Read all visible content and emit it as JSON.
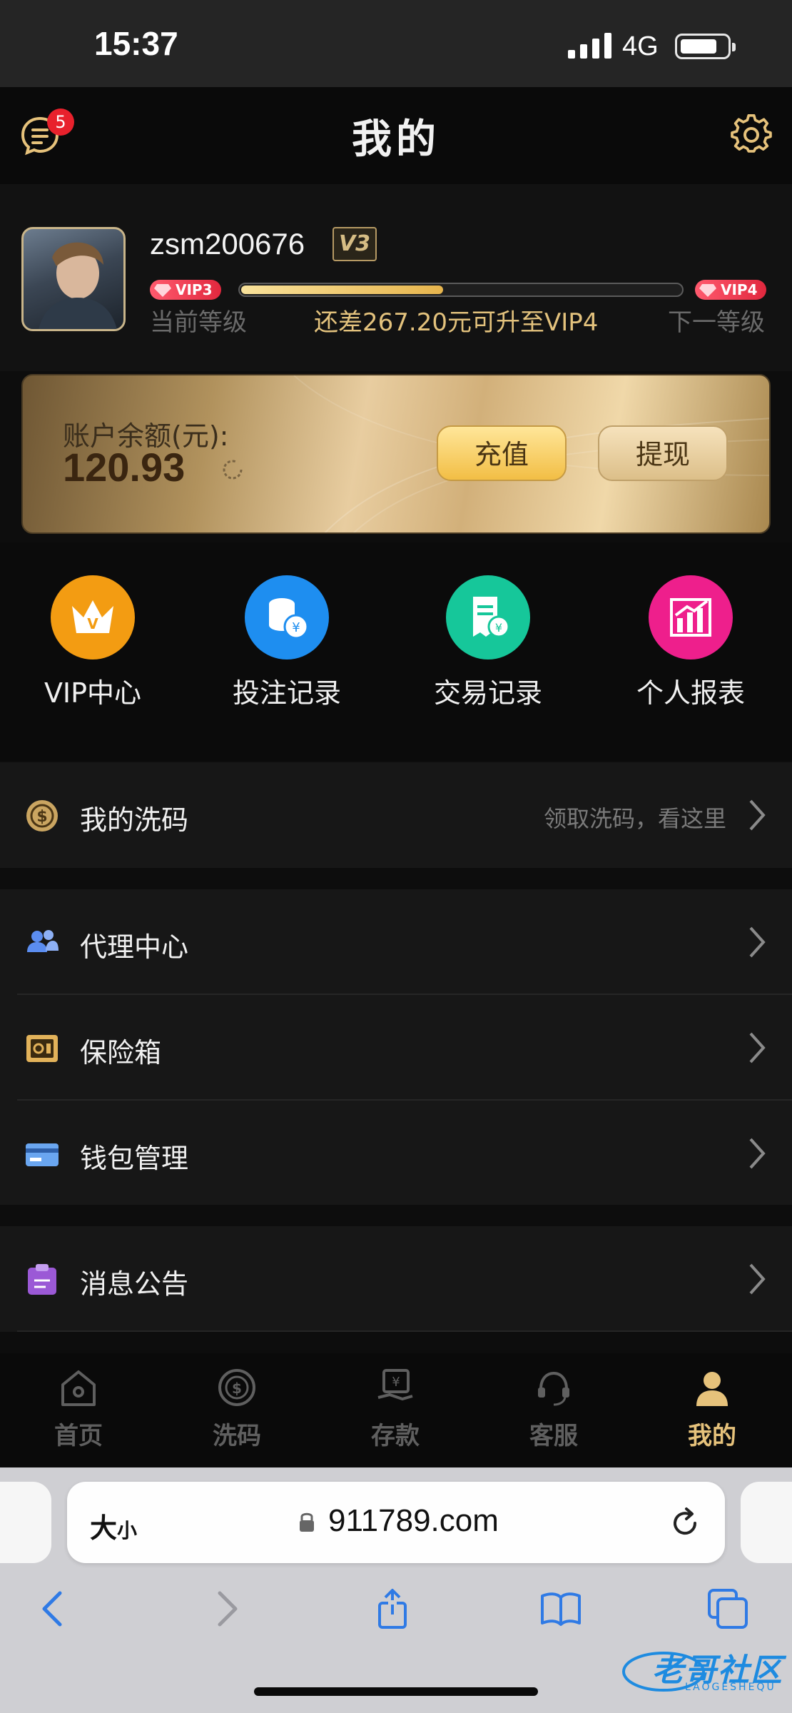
{
  "status_bar": {
    "time": "15:37",
    "network": "4G"
  },
  "header": {
    "title": "我的",
    "message_badge": "5"
  },
  "profile": {
    "username": "zsm200676",
    "level_badge": "V3",
    "current_vip": "VIP3",
    "next_vip": "VIP4",
    "current_level_label": "当前等级",
    "next_level_label": "下一等级",
    "upgrade_tip": "还差267.20元可升至VIP4",
    "progress_fraction": 0.46
  },
  "balance": {
    "label": "账户余额(元):",
    "value": "120.93",
    "charge_label": "充值",
    "withdraw_label": "提现"
  },
  "quick_actions": [
    {
      "label": "VIP中心",
      "icon": "crown-icon",
      "color": "#f39c12"
    },
    {
      "label": "投注记录",
      "icon": "coins-icon",
      "color": "#1e8ef0"
    },
    {
      "label": "交易记录",
      "icon": "receipt-icon",
      "color": "#16c79a"
    },
    {
      "label": "个人报表",
      "icon": "chart-icon",
      "color": "#ee1f8c"
    }
  ],
  "menu": {
    "rebate": {
      "label": "我的洗码",
      "hint": "领取洗码，看这里"
    },
    "agent": {
      "label": "代理中心"
    },
    "safe": {
      "label": "保险箱"
    },
    "wallet": {
      "label": "钱包管理"
    },
    "notice": {
      "label": "消息公告"
    }
  },
  "tabbar": [
    {
      "label": "首页",
      "icon": "home-icon",
      "active": false
    },
    {
      "label": "洗码",
      "icon": "rebate-icon",
      "active": false
    },
    {
      "label": "存款",
      "icon": "deposit-icon",
      "active": false
    },
    {
      "label": "客服",
      "icon": "support-icon",
      "active": false
    },
    {
      "label": "我的",
      "icon": "user-icon",
      "active": true
    }
  ],
  "browser": {
    "text_size": "大",
    "text_size_small": "小",
    "url": "911789.com"
  },
  "watermark": {
    "text": "老哥社区",
    "sub": "LAOGESHEQU"
  },
  "colors": {
    "gold": "#e6c27b",
    "background": "#0d0d0d",
    "badge_red": "#e8212c"
  }
}
